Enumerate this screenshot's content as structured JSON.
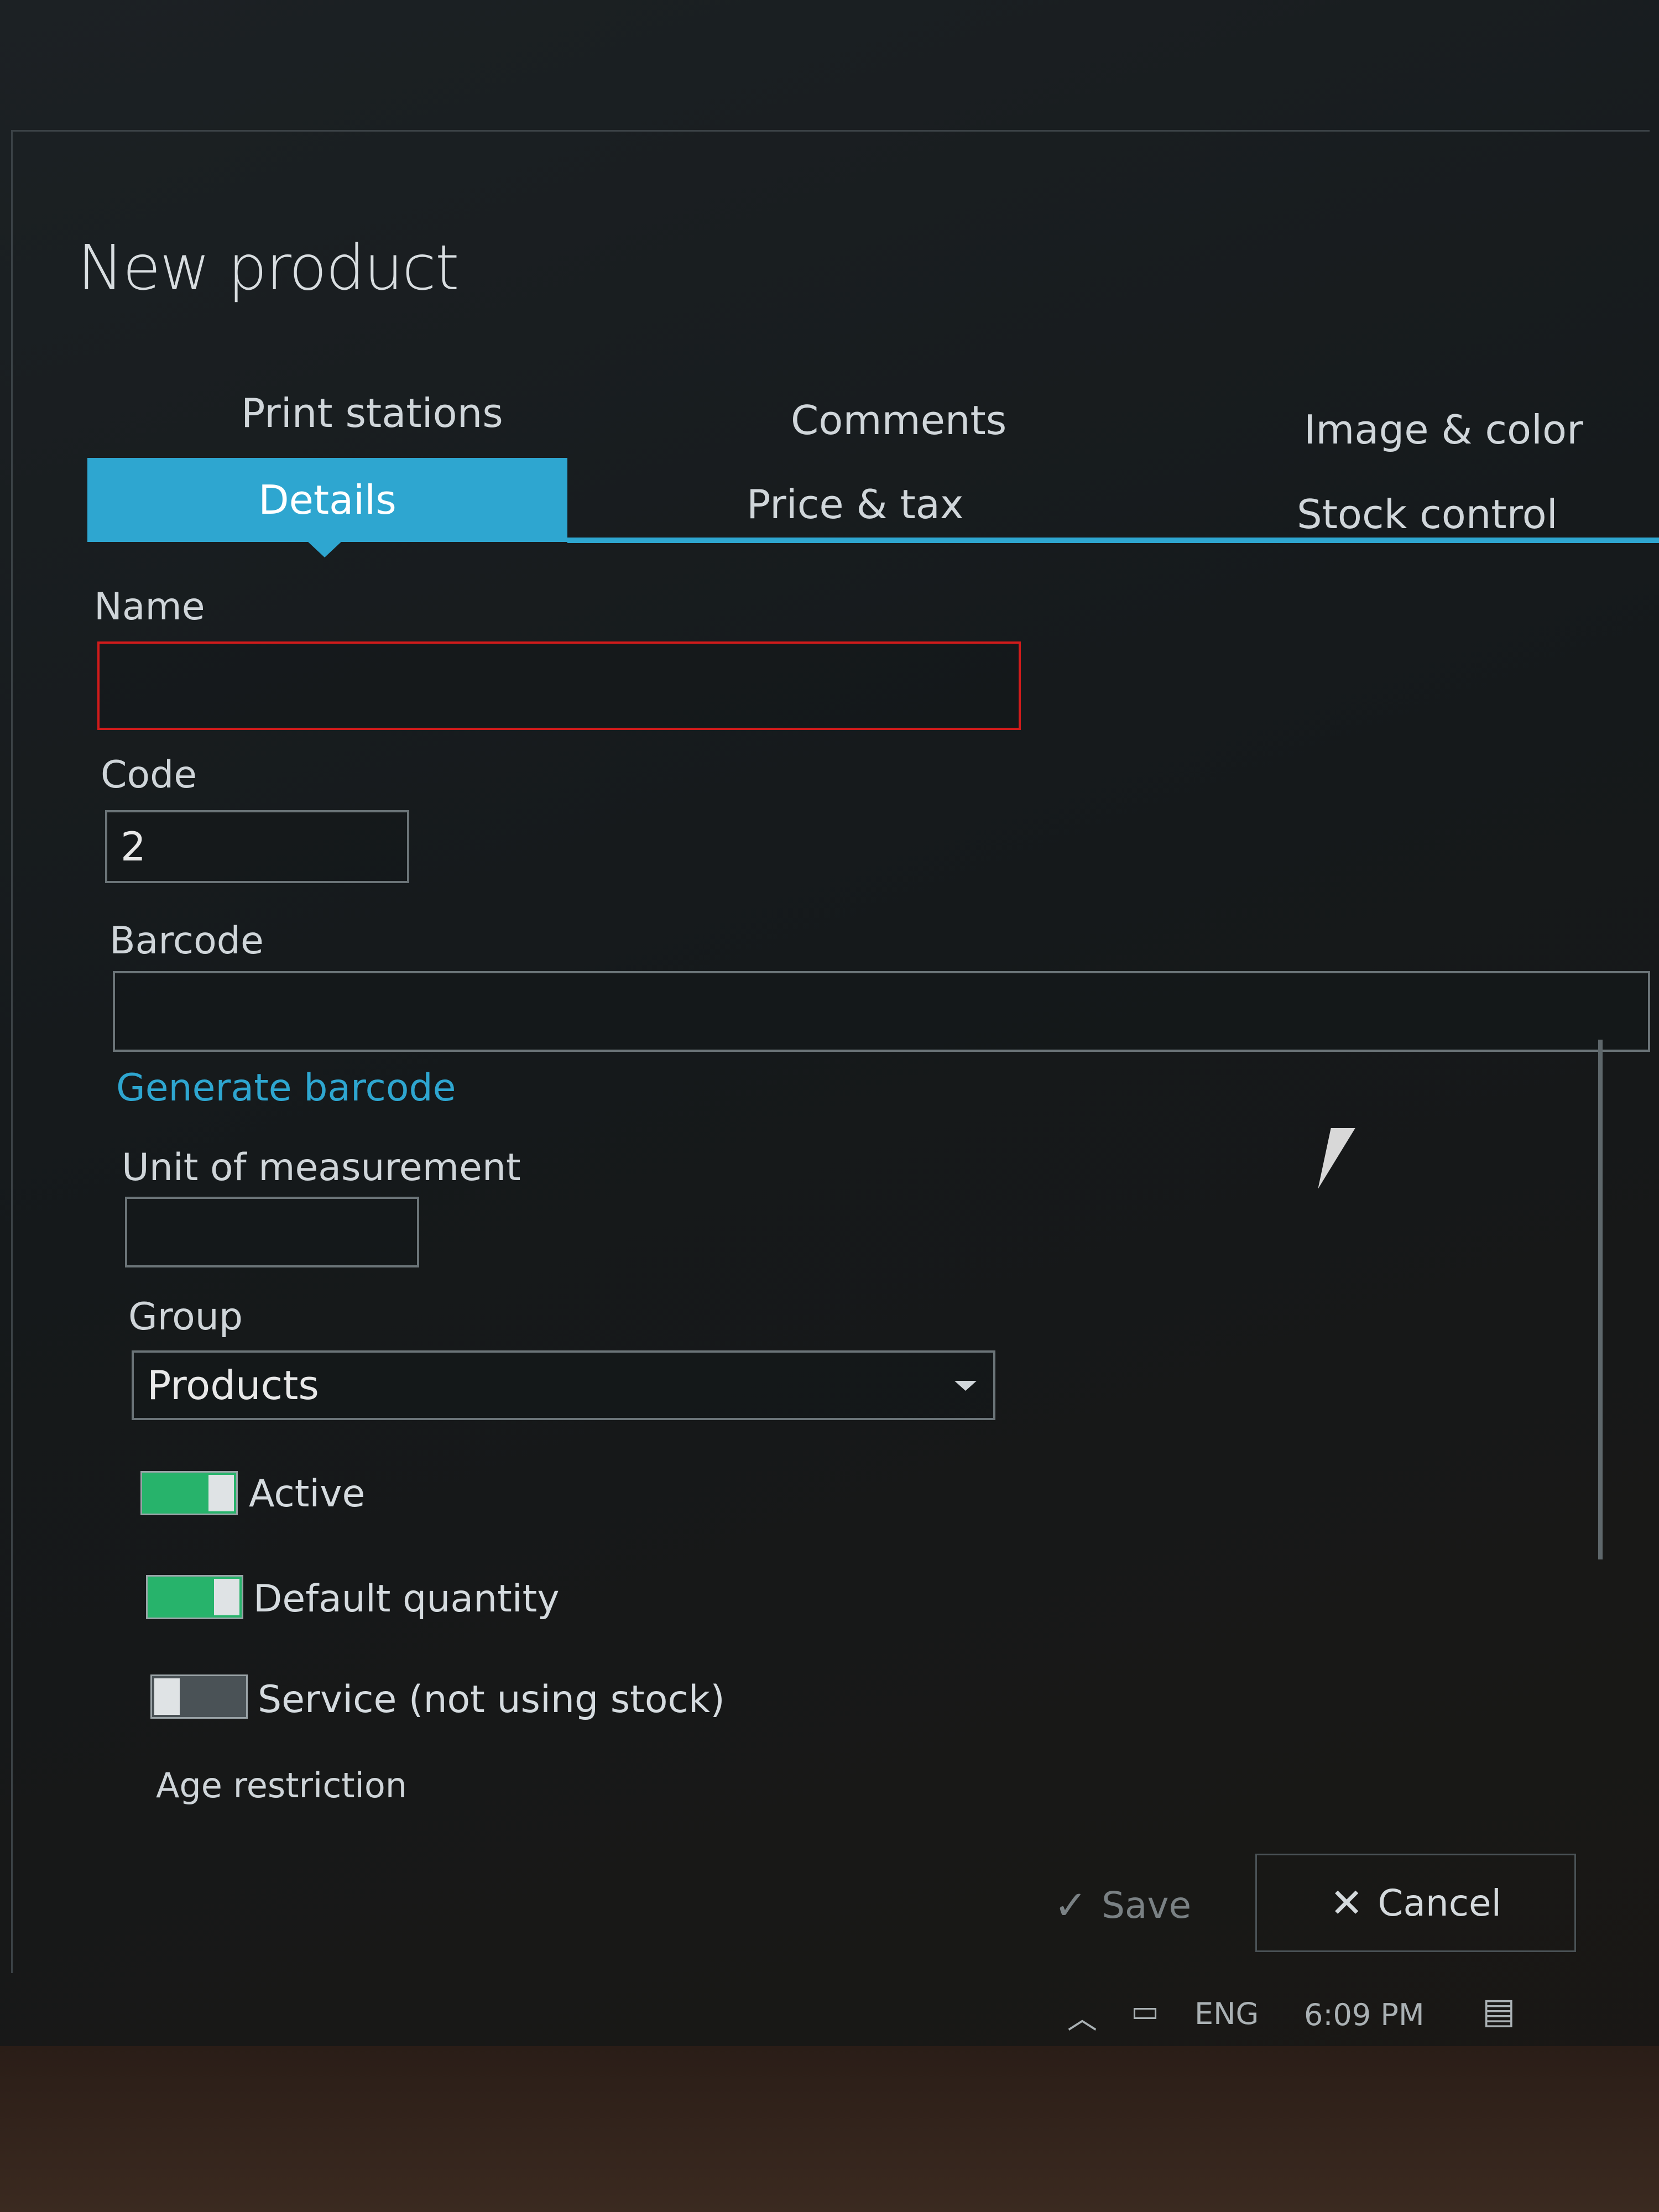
{
  "dialog": {
    "title": "New product"
  },
  "tabs": [
    {
      "label": "Print stations"
    },
    {
      "label": "Comments"
    },
    {
      "label": "Image & color"
    },
    {
      "label": "Details",
      "active": true
    },
    {
      "label": "Price & tax"
    },
    {
      "label": "Stock control"
    }
  ],
  "form": {
    "name": {
      "label": "Name",
      "value": ""
    },
    "code": {
      "label": "Code",
      "value": "2"
    },
    "barcode": {
      "label": "Barcode",
      "value": ""
    },
    "generate_barcode": "Generate barcode",
    "unit": {
      "label": "Unit of measurement",
      "value": ""
    },
    "group": {
      "label": "Group",
      "value": "Products"
    },
    "toggles": [
      {
        "label": "Active",
        "on": true
      },
      {
        "label": "Default quantity",
        "on": true
      },
      {
        "label": "Service (not using stock)",
        "on": false
      }
    ],
    "age_restriction": {
      "label": "Age restriction"
    }
  },
  "footer": {
    "save": {
      "label": "Save",
      "icon": "check-icon",
      "disabled": true
    },
    "cancel": {
      "label": "Cancel",
      "icon": "close-icon"
    }
  },
  "taskbar": {
    "language": "ENG",
    "time": "6:09 PM"
  },
  "colors": {
    "accent": "#2ea6d0",
    "error": "#d11b1b",
    "toggle_on": "#27b36b"
  }
}
